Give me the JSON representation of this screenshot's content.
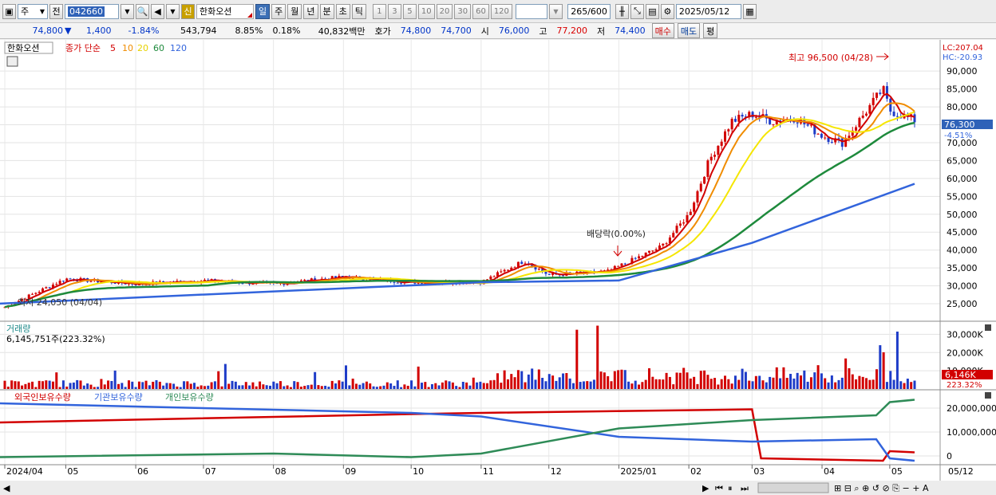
{
  "toolbar": {
    "menu_icon": "window-icon",
    "market": "주",
    "all": "전",
    "stock_code": "042660",
    "stock_name": "한화오션",
    "credit_badge": "신",
    "periods": [
      "일",
      "주",
      "월",
      "년",
      "분",
      "초",
      "틱"
    ],
    "active_period": "일",
    "ticks": [
      "1",
      "3",
      "5",
      "10",
      "20",
      "30",
      "60",
      "120"
    ],
    "count": "265",
    "count_total": "/600",
    "date": "2025/05/12"
  },
  "quote": {
    "price": "74,800",
    "change": "1,400",
    "change_pct": "-1.84%",
    "volume": "543,794",
    "turnover": "8.85%",
    "ratio": "0.18%",
    "amount": "40,832백만",
    "ask_label": "호가",
    "ask": "74,800",
    "bid": "74,700",
    "open_label": "시",
    "open": "76,000",
    "high_label": "고",
    "high": "77,200",
    "low_label": "저",
    "low": "74,400",
    "buy": "매수",
    "sell": "매도",
    "eval": "평"
  },
  "price_panel": {
    "stock_label": "한화오션",
    "ma_label": "종가 단순",
    "ma_periods": [
      "5",
      "10",
      "20",
      "60",
      "120"
    ],
    "ma_colors": [
      "#d20000",
      "#f08c00",
      "#f5e600",
      "#1e8a3c",
      "#3264dc"
    ],
    "lc": "LC:207.04",
    "hc": "HC:-20.93",
    "high_note": "최고 96,500 (04/28)",
    "low_note": "최저 24,050 (04/04)",
    "dividend_note": "배당락(0.00%)",
    "current_price": "76,300",
    "current_pct": "-4.51%",
    "y_ticks": [
      "90,000",
      "85,000",
      "80,000",
      "75,000",
      "70,000",
      "65,000",
      "60,000",
      "55,000",
      "50,000",
      "45,000",
      "40,000",
      "35,000",
      "30,000",
      "25,000"
    ]
  },
  "volume_panel": {
    "title": "거래량",
    "value": "6,145,751주(223.32%)",
    "current": "6,146K",
    "current_pct": "223.32%",
    "y_ticks": [
      "30,000K",
      "20,000K",
      "10,000K"
    ]
  },
  "holding_panel": {
    "legend": [
      "외국인보유수량",
      "기관보유수량",
      "개인보유수량"
    ],
    "legend_colors": [
      "#d20000",
      "#3264dc",
      "#2e8b57"
    ],
    "y_ticks": [
      "20,000,000",
      "10,000,000",
      "0"
    ]
  },
  "x_axis": [
    "2024/04",
    "05",
    "06",
    "07",
    "08",
    "09",
    "10",
    "11",
    "12",
    "2025/01",
    "02",
    "03",
    "04",
    "05",
    "05/12"
  ],
  "chart_data": {
    "type": "line",
    "price_y_range": [
      21000,
      96500
    ],
    "price_points": {
      "x": [
        "2024/04/04",
        "2024/05",
        "2024/06",
        "2024/07",
        "2024/08",
        "2024/09",
        "2024/10",
        "2024/11",
        "2024/11/20",
        "2024/12",
        "2024/12/27",
        "2025/01/20",
        "2025/02",
        "2025/02/10",
        "2025/02/20",
        "2025/03",
        "2025/03/10",
        "2025/03/20",
        "2025/04",
        "2025/04/10",
        "2025/04/28",
        "2025/05",
        "2025/05/12"
      ],
      "close": [
        24050,
        32000,
        30500,
        31500,
        30500,
        32500,
        31000,
        31000,
        37000,
        33000,
        34000,
        41000,
        50000,
        65000,
        76000,
        78000,
        76000,
        77000,
        72000,
        70000,
        85000,
        79000,
        76300
      ]
    },
    "ma120": {
      "x": [
        "2024/04",
        "2024/11",
        "2025/01",
        "2025/03",
        "2025/05/12"
      ],
      "values": [
        25000,
        31000,
        31500,
        42000,
        58500
      ]
    },
    "volume_y_range": [
      0,
      35000
    ],
    "volume_unit": "K",
    "holdings_y_range": [
      -3000000,
      25000000
    ],
    "holdings_series": [
      {
        "name": "외국인보유수량",
        "x": [
          "2024/04",
          "2024/10",
          "2024/11",
          "2025/03",
          "2025/03/05",
          "2025/04/28",
          "2025/05",
          "2025/05/12"
        ],
        "values": [
          14000000,
          17500000,
          18000000,
          19500000,
          -1000000,
          -2000000,
          2000000,
          1500000
        ]
      },
      {
        "name": "기관보유수량",
        "x": [
          "2024/04",
          "2024/10",
          "2024/11",
          "2025/01",
          "2025/03",
          "2025/04/25",
          "2025/05",
          "2025/05/12"
        ],
        "values": [
          22000000,
          18000000,
          16500000,
          8000000,
          6000000,
          7000000,
          -1000000,
          -2000000
        ]
      },
      {
        "name": "개인보유수량",
        "x": [
          "2024/04",
          "2024/08",
          "2024/10",
          "2024/11",
          "2025/01",
          "2025/03",
          "2025/04/25",
          "2025/05",
          "2025/05/12"
        ],
        "values": [
          -500000,
          1000000,
          -500000,
          1000000,
          11500000,
          15000000,
          17000000,
          22500000,
          23500000
        ]
      }
    ]
  }
}
